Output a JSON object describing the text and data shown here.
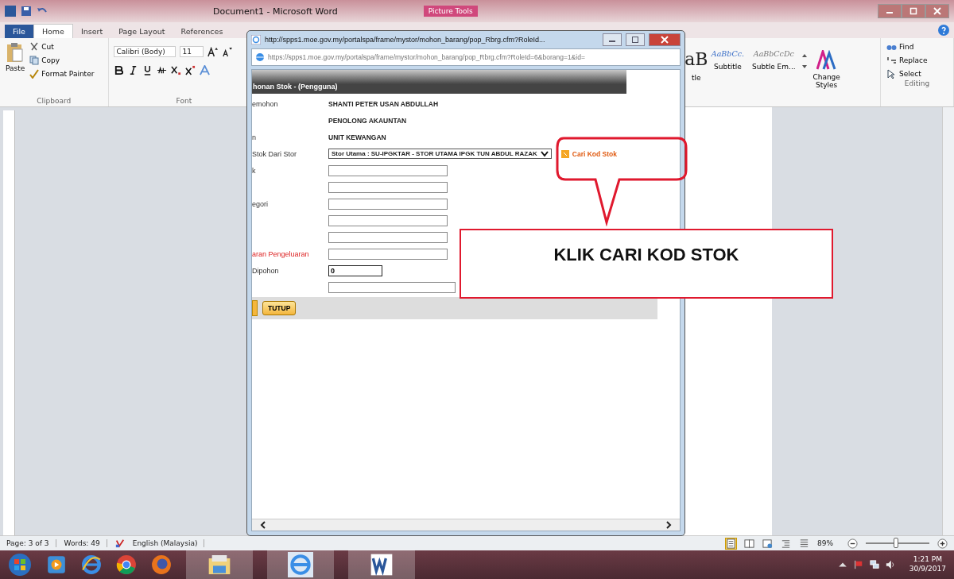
{
  "window": {
    "title": "Document1 - Microsoft Word",
    "context_tab": "Picture Tools"
  },
  "tabs": [
    {
      "label": "File",
      "selected": false
    },
    {
      "label": "Home",
      "selected": true
    },
    {
      "label": "Insert",
      "selected": false
    },
    {
      "label": "Page Layout",
      "selected": false
    },
    {
      "label": "References",
      "selected": false
    }
  ],
  "clipboard": {
    "paste": "Paste",
    "cut": "Cut",
    "copy": "Copy",
    "format_painter": "Format Painter",
    "label": "Clipboard"
  },
  "font": {
    "family": "Calibri (Body)",
    "size": "11",
    "label": "Font"
  },
  "styles": [
    {
      "preview": "aB",
      "name": "tle"
    },
    {
      "preview": "AaBbCc.",
      "name": "Subtitle"
    },
    {
      "preview": "AaBbCcDc",
      "name": "Subtle Em..."
    }
  ],
  "change_styles": "Change Styles",
  "editing": {
    "find": "Find",
    "replace": "Replace",
    "select": "Select",
    "label": "Editing"
  },
  "popup": {
    "title": "http://spps1.moe.gov.my/portalspa/frame/mystor/mohon_barang/pop_Rbrg.cfm?RoleId...",
    "address": "https://spps1.moe.gov.my/portalspa/frame/mystor/mohon_barang/pop_Rbrg.cfm?RoleId=6&borang=1&id=",
    "header": "honan Stok - (Pengguna)",
    "rows": [
      {
        "kind": "text",
        "label": "emohon",
        "value": "SHANTI PETER USAN ABDULLAH",
        "required": false
      },
      {
        "kind": "text",
        "value": "PENOLONG AKAUNTAN"
      },
      {
        "kind": "text",
        "label": "n",
        "value": "UNIT KEWANGAN",
        "required": false
      },
      {
        "kind": "select",
        "label": "Stok Dari Stor",
        "value": "Stor Utama : SU-IPGKTAR - STOR UTAMA IPGK TUN ABDUL RAZAK",
        "link": "Cari Kod Stok",
        "required": false
      },
      {
        "kind": "input",
        "label": "k",
        "required": false
      },
      {
        "kind": "input"
      },
      {
        "kind": "input",
        "label": "egori",
        "required": false
      },
      {
        "kind": "input"
      },
      {
        "kind": "input"
      },
      {
        "kind": "input",
        "label": "aran Pengeluaran",
        "required": true
      },
      {
        "kind": "short",
        "label": "Dipohon",
        "value": "0",
        "required": false
      },
      {
        "kind": "wide"
      }
    ],
    "close_button": "TUTUP"
  },
  "callout": {
    "text": "KLIK CARI KOD STOK"
  },
  "status_bar": {
    "page": "Page: 3 of 3",
    "words": "Words: 49",
    "language": "English (Malaysia)",
    "zoom": "89%",
    "zoom_level": {
      "level": 0.47
    }
  },
  "taskbar": {
    "time": "1:21 PM",
    "date": "30/9/2017"
  }
}
